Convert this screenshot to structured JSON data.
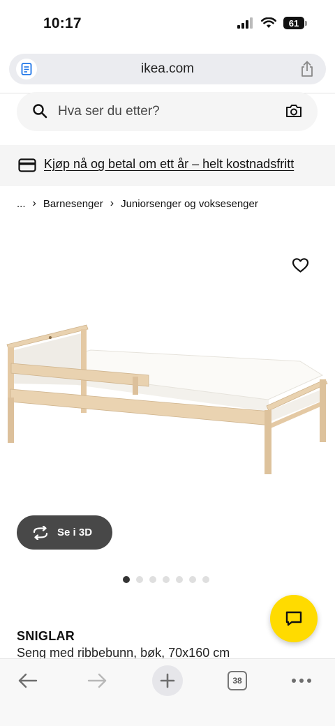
{
  "status_bar": {
    "time": "10:17",
    "battery_level": "61",
    "icons": [
      "signal-icon",
      "wifi-icon",
      "battery-icon"
    ]
  },
  "browser": {
    "url": "ikea.com",
    "tab_count": "38"
  },
  "search": {
    "placeholder": "Hva ser du etter?"
  },
  "promo": {
    "text": "Kjøp nå og betal om ett år – helt kostnadsfritt"
  },
  "breadcrumb": {
    "items": [
      "...",
      "Barnesenger",
      "Juniorsenger og voksesenger"
    ],
    "separator": "›"
  },
  "product": {
    "view_3d_label": "Se i 3D",
    "carousel_dot_count": 7,
    "carousel_active_index": 0,
    "name": "SNIGLAR",
    "description": "Seng med ribbebunn, bøk,",
    "size": "70x160 cm"
  },
  "colors": {
    "accent_yellow": "#ffdb00",
    "button_dark": "#484848",
    "surface_grey": "#f5f5f5",
    "wood": "#e8cfad"
  }
}
